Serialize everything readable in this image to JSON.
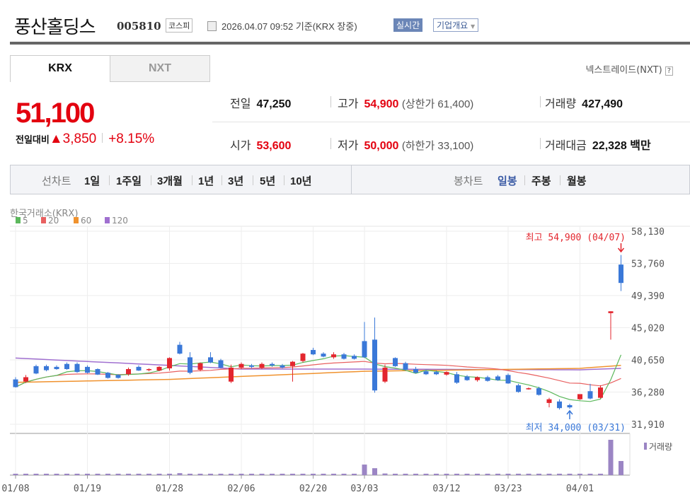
{
  "header": {
    "title": "풍산홀딩스",
    "code": "005810",
    "market": "코스피",
    "datetime": "2026.04.07 09:52",
    "basis": "기준(KRX 장중)",
    "realtime": "실시간",
    "company_info": "기업개요"
  },
  "tabs": [
    {
      "label": "KRX",
      "active": true
    },
    {
      "label": "NXT",
      "active": false
    }
  ],
  "nxt_link": "넥스트레이드(NXT)",
  "help_icon": "?",
  "quote": {
    "price": "51,100",
    "change_label": "전일대비",
    "change": "3,850",
    "change_pct": "+8.15%",
    "prev_label": "전일",
    "prev": "47,250",
    "high_label": "고가",
    "high": "54,900",
    "upper_limit": "(상한가 61,400)",
    "volume_label": "거래량",
    "volume": "427,490",
    "open_label": "시가",
    "open": "53,600",
    "low_label": "저가",
    "low": "50,000",
    "lower_limit": "(하한가 33,100)",
    "amount_label": "거래대금",
    "amount": "22,328 백만"
  },
  "nav": {
    "line_label": "선차트",
    "line_items": [
      "1일",
      "1주일",
      "3개월",
      "1년",
      "3년",
      "5년",
      "10년"
    ],
    "candle_label": "봉차트",
    "candle_items": [
      "일봉",
      "주봉",
      "월봉"
    ],
    "active_candle": "일봉"
  },
  "colors": {
    "up": "#e3262e",
    "down": "#3a78d8",
    "ma5": "#5cb85c",
    "ma20": "#e86060",
    "ma60": "#f0922e",
    "ma120": "#a070d0",
    "volume": "#9b85c4"
  },
  "chart_data": {
    "type": "candlestick",
    "source": "한국거래소(KRX)",
    "legend": [
      {
        "name": "5",
        "color": "#5cb85c"
      },
      {
        "name": "20",
        "color": "#e86060"
      },
      {
        "name": "60",
        "color": "#f0922e"
      },
      {
        "name": "120",
        "color": "#a070d0"
      }
    ],
    "ylim": [
      31910,
      58130
    ],
    "y_ticks": [
      "58,130",
      "53,760",
      "49,390",
      "45,020",
      "40,650",
      "36,280",
      "31,910"
    ],
    "x_ticks": [
      {
        "i": 0,
        "label": "01/08"
      },
      {
        "i": 7,
        "label": "01/19"
      },
      {
        "i": 15,
        "label": "01/28"
      },
      {
        "i": 22,
        "label": "02/06"
      },
      {
        "i": 29,
        "label": "02/20"
      },
      {
        "i": 34,
        "label": "03/03"
      },
      {
        "i": 42,
        "label": "03/12"
      },
      {
        "i": 48,
        "label": "03/23"
      },
      {
        "i": 55,
        "label": "04/01"
      }
    ],
    "high_annotation": "최고 54,900 (04/07)",
    "low_annotation": "최저 34,000 (03/31)",
    "volume_label": "거래량",
    "ohlc": [
      [
        38000,
        38300,
        36900,
        36950
      ],
      [
        37700,
        38600,
        37500,
        38300
      ],
      [
        39800,
        40000,
        38700,
        38800
      ],
      [
        39800,
        40000,
        39100,
        39250
      ],
      [
        39700,
        39900,
        39300,
        39400
      ],
      [
        40100,
        40300,
        39300,
        39400
      ],
      [
        40100,
        40300,
        38900,
        39000
      ],
      [
        39700,
        39900,
        38800,
        38900
      ],
      [
        39400,
        39500,
        38600,
        38650
      ],
      [
        38900,
        39000,
        38100,
        38200
      ],
      [
        38600,
        38700,
        38100,
        38200
      ],
      [
        38700,
        39600,
        38500,
        39400
      ],
      [
        39700,
        39900,
        39150,
        39200
      ],
      [
        39300,
        39500,
        39100,
        39400
      ],
      [
        39200,
        39800,
        39100,
        39700
      ],
      [
        39500,
        41000,
        39200,
        40900
      ],
      [
        42700,
        43100,
        41400,
        41500
      ],
      [
        41000,
        41700,
        38700,
        38900
      ],
      [
        39300,
        40300,
        39100,
        40200
      ],
      [
        41000,
        41700,
        40200,
        40300
      ],
      [
        40600,
        40800,
        39500,
        39600
      ],
      [
        37700,
        40000,
        37500,
        39600
      ],
      [
        39600,
        40300,
        39400,
        40100
      ],
      [
        39900,
        40100,
        39500,
        39700
      ],
      [
        39600,
        40300,
        39400,
        40100
      ],
      [
        40100,
        40300,
        39700,
        39900
      ],
      [
        39900,
        40100,
        39500,
        39600
      ],
      [
        39800,
        40500,
        37700,
        40400
      ],
      [
        40500,
        41600,
        40300,
        41500
      ],
      [
        42000,
        42300,
        41300,
        41400
      ],
      [
        41500,
        41700,
        41000,
        41100
      ],
      [
        41000,
        41700,
        40800,
        41400
      ],
      [
        41400,
        41600,
        40700,
        40800
      ],
      [
        41200,
        41400,
        40700,
        40800
      ],
      [
        43200,
        45800,
        40900,
        41000
      ],
      [
        43400,
        46400,
        36200,
        36500
      ],
      [
        37700,
        40000,
        37500,
        39600
      ],
      [
        40900,
        41000,
        39700,
        39800
      ],
      [
        40200,
        40400,
        39200,
        39300
      ],
      [
        39400,
        39700,
        38800,
        38900
      ],
      [
        39100,
        39300,
        38600,
        38700
      ],
      [
        39000,
        39200,
        38600,
        38700
      ],
      [
        38650,
        39100,
        38500,
        39000
      ],
      [
        38700,
        39000,
        37400,
        37550
      ],
      [
        38400,
        38600,
        37800,
        37900
      ],
      [
        37900,
        38400,
        37700,
        38300
      ],
      [
        38300,
        38500,
        37700,
        37800
      ],
      [
        38400,
        38600,
        37800,
        37900
      ],
      [
        38600,
        38800,
        37400,
        37450
      ],
      [
        37200,
        37400,
        36200,
        36300
      ],
      [
        36650,
        36900,
        36600,
        36800
      ],
      [
        36800,
        37000,
        35800,
        35900
      ],
      [
        34800,
        35500,
        34200,
        35300
      ],
      [
        35000,
        35300,
        33900,
        34100
      ],
      [
        34500,
        34700,
        34000,
        34200
      ],
      [
        35300,
        35800,
        35200,
        36000
      ],
      [
        36400,
        37400,
        35300,
        35400
      ],
      [
        35500,
        37200,
        35400,
        36900
      ],
      [
        47000,
        47250,
        43400,
        47250
      ],
      [
        53600,
        54900,
        50000,
        51100
      ]
    ],
    "volumes": [
      30000,
      30000,
      30000,
      30000,
      30000,
      30000,
      30000,
      30000,
      30000,
      30000,
      30000,
      30000,
      30000,
      30000,
      30000,
      30000,
      60000,
      40000,
      30000,
      30000,
      30000,
      30000,
      30000,
      30000,
      30000,
      30000,
      30000,
      30000,
      40000,
      40000,
      30000,
      30000,
      30000,
      30000,
      320000,
      210000,
      50000,
      40000,
      40000,
      30000,
      30000,
      30000,
      30000,
      30000,
      30000,
      30000,
      40000,
      40000,
      40000,
      30000,
      30000,
      30000,
      30000,
      30000,
      30000,
      30000,
      30000,
      30000,
      1070000,
      427490
    ],
    "ma60": [
      [
        0,
        37600
      ],
      [
        15,
        38000
      ],
      [
        34,
        39100
      ],
      [
        55,
        39500
      ],
      [
        59,
        39900
      ]
    ],
    "ma120": [
      [
        0,
        40900
      ],
      [
        15,
        39900
      ],
      [
        22,
        39400
      ],
      [
        34,
        39400
      ],
      [
        55,
        39300
      ],
      [
        59,
        39500
      ]
    ]
  }
}
